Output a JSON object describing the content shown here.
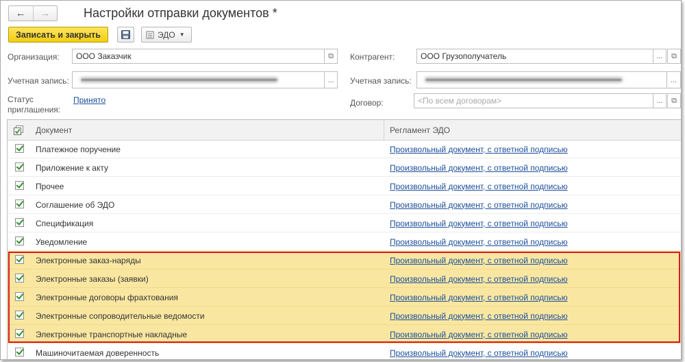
{
  "header": {
    "title": "Настройки отправки документов *",
    "back_icon": "←",
    "forward_icon": "→"
  },
  "toolbar": {
    "save_close_label": "Записать и закрыть",
    "save_icon": "floppy-disk-icon",
    "edo_label": "ЭДО"
  },
  "form": {
    "organization_label": "Организация:",
    "organization_value": "ООО Заказчик",
    "account_label": "Учетная запись:",
    "status_label_1": "Статус",
    "status_label_2": "приглашения:",
    "status_value": "Принято",
    "counterparty_label": "Контрагент:",
    "counterparty_value": "ООО Грузополучатель",
    "counterparty_account_label": "Учетная запись:",
    "contract_label": "Договор:",
    "contract_placeholder": "<По всем договорам>",
    "dots": "...",
    "open_icon": "⧉"
  },
  "table": {
    "columns": [
      "Документ",
      "Регламент ЭДО"
    ],
    "rows": [
      {
        "document": "Платежное поручение",
        "regulation": "Произвольный документ, с ответной подписью",
        "checked": true,
        "highlighted": false
      },
      {
        "document": "Приложение к акту",
        "regulation": "Произвольный документ, с ответной подписью",
        "checked": true,
        "highlighted": false
      },
      {
        "document": "Прочее",
        "regulation": "Произвольный документ, с ответной подписью",
        "checked": true,
        "highlighted": false
      },
      {
        "document": "Соглашение об ЭДО",
        "regulation": "Произвольный документ, с ответной подписью",
        "checked": true,
        "highlighted": false
      },
      {
        "document": "Спецификация",
        "regulation": "Произвольный документ, с ответной подписью",
        "checked": true,
        "highlighted": false
      },
      {
        "document": "Уведомление",
        "regulation": "Произвольный документ, с ответной подписью",
        "checked": true,
        "highlighted": false
      },
      {
        "document": "Электронные заказ-наряды",
        "regulation": "Произвольный документ, с ответной подписью",
        "checked": true,
        "highlighted": true
      },
      {
        "document": "Электронные заказы (заявки)",
        "regulation": "Произвольный документ, с ответной подписью",
        "checked": true,
        "highlighted": true
      },
      {
        "document": "Электронные договоры фрахтования",
        "regulation": "Произвольный документ, с ответной подписью",
        "checked": true,
        "highlighted": true
      },
      {
        "document": "Электронные сопроводительные ведомости",
        "regulation": "Произвольный документ, с ответной подписью",
        "checked": true,
        "highlighted": true
      },
      {
        "document": "Электронные транспортные накладные",
        "regulation": "Произвольный документ, с ответной подписью",
        "checked": true,
        "highlighted": true
      },
      {
        "document": "Машиночитаемая доверенность",
        "regulation": "Произвольный документ, с ответной подписью",
        "checked": true,
        "highlighted": false
      }
    ]
  },
  "colors": {
    "accent_yellow": "#f2cd12",
    "highlight_row": "#f9e7a1",
    "annotation_red": "#e0141e",
    "link_blue": "#1b4f9c",
    "check_green": "#2f8e2f"
  }
}
